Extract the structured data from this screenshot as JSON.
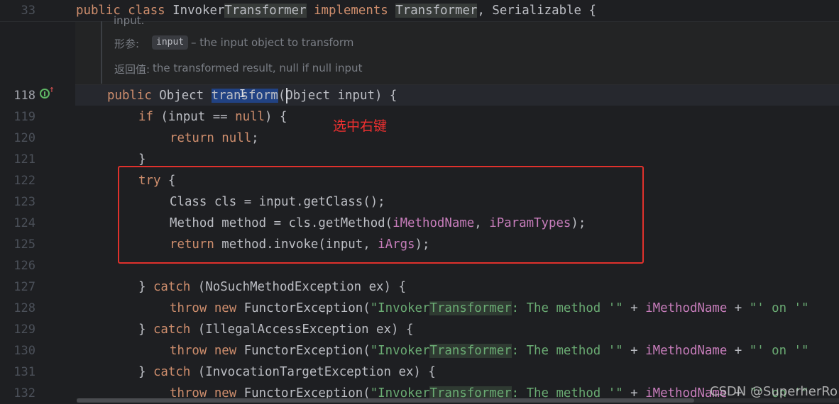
{
  "editor": {
    "sticky_header": {
      "line_number": "33",
      "code": [
        {
          "t": "public class ",
          "c": "kw"
        },
        {
          "t": "Invoker",
          "c": ""
        },
        {
          "t": "Transformer",
          "c": "hl"
        },
        {
          "t": " ",
          "c": ""
        },
        {
          "t": "implements",
          "c": "kw"
        },
        {
          "t": " ",
          "c": ""
        },
        {
          "t": "Transformer",
          "c": "hl"
        },
        {
          "t": ", Serializable {",
          "c": ""
        }
      ]
    },
    "doc_popup": {
      "cut_text": "input.",
      "param_label": "形参:",
      "param_name": "input",
      "param_desc": "– the input object to transform",
      "return_label": "返回值:",
      "return_desc": "the transformed result, null if null input"
    },
    "lines": [
      {
        "num": "118",
        "code": [
          {
            "t": "public ",
            "c": "kw"
          },
          {
            "t": "Object ",
            "c": ""
          },
          {
            "t": "transform",
            "c": "sel"
          },
          {
            "t": "(Object input) {",
            "c": ""
          }
        ]
      },
      {
        "num": "119",
        "code": [
          {
            "t": "if ",
            "c": "kw"
          },
          {
            "t": "(input == ",
            "c": ""
          },
          {
            "t": "null",
            "c": "kw"
          },
          {
            "t": ") {",
            "c": ""
          }
        ]
      },
      {
        "num": "120",
        "code": [
          {
            "t": "return null",
            "c": "kw"
          },
          {
            "t": ";",
            "c": ""
          }
        ]
      },
      {
        "num": "121",
        "code": [
          {
            "t": "}",
            "c": ""
          }
        ]
      },
      {
        "num": "122",
        "code": [
          {
            "t": "try ",
            "c": "kw"
          },
          {
            "t": "{",
            "c": ""
          }
        ]
      },
      {
        "num": "123",
        "code": [
          {
            "t": "Class cls = input.getClass();",
            "c": ""
          }
        ]
      },
      {
        "num": "124",
        "code": [
          {
            "t": "Method method = cls.getMethod(",
            "c": ""
          },
          {
            "t": "iMethodName",
            "c": "fld"
          },
          {
            "t": ", ",
            "c": ""
          },
          {
            "t": "iParamTypes",
            "c": "fld"
          },
          {
            "t": ");",
            "c": ""
          }
        ]
      },
      {
        "num": "125",
        "code": [
          {
            "t": "return ",
            "c": "kw"
          },
          {
            "t": "method.invoke(input, ",
            "c": ""
          },
          {
            "t": "iArgs",
            "c": "fld"
          },
          {
            "t": ");",
            "c": ""
          }
        ]
      },
      {
        "num": "126",
        "code": []
      },
      {
        "num": "127",
        "code": [
          {
            "t": "} ",
            "c": ""
          },
          {
            "t": "catch ",
            "c": "kw"
          },
          {
            "t": "(NoSuchMethodException ex) {",
            "c": ""
          }
        ]
      },
      {
        "num": "128",
        "code": [
          {
            "t": "throw new ",
            "c": "kw"
          },
          {
            "t": "FunctorException(",
            "c": ""
          },
          {
            "t": "\"Invoker",
            "c": "str"
          },
          {
            "t": "Transformer",
            "c": "str strhl"
          },
          {
            "t": ": The method '\"",
            "c": "str"
          },
          {
            "t": " + ",
            "c": ""
          },
          {
            "t": "iMethodName",
            "c": "fld"
          },
          {
            "t": " + ",
            "c": ""
          },
          {
            "t": "\"' on '\"",
            "c": "str"
          }
        ]
      },
      {
        "num": "129",
        "code": [
          {
            "t": "} ",
            "c": ""
          },
          {
            "t": "catch ",
            "c": "kw"
          },
          {
            "t": "(IllegalAccessException ex) {",
            "c": ""
          }
        ]
      },
      {
        "num": "130",
        "code": [
          {
            "t": "throw new ",
            "c": "kw"
          },
          {
            "t": "FunctorException(",
            "c": ""
          },
          {
            "t": "\"Invoker",
            "c": "str"
          },
          {
            "t": "Transformer",
            "c": "str strhl"
          },
          {
            "t": ": The method '\"",
            "c": "str"
          },
          {
            "t": " + ",
            "c": ""
          },
          {
            "t": "iMethodName",
            "c": "fld"
          },
          {
            "t": " + ",
            "c": ""
          },
          {
            "t": "\"' on '\"",
            "c": "str"
          }
        ]
      },
      {
        "num": "131",
        "code": [
          {
            "t": "} ",
            "c": ""
          },
          {
            "t": "catch ",
            "c": "kw"
          },
          {
            "t": "(InvocationTargetException ex) {",
            "c": ""
          }
        ]
      },
      {
        "num": "132",
        "code": [
          {
            "t": "throw new ",
            "c": "kw"
          },
          {
            "t": "FunctorException(",
            "c": ""
          },
          {
            "t": "\"Invoker",
            "c": "str"
          },
          {
            "t": "Transformer",
            "c": "str strhl"
          },
          {
            "t": ": The method '\"",
            "c": "str"
          },
          {
            "t": " + ",
            "c": ""
          },
          {
            "t": "iMethodName",
            "c": "fld"
          },
          {
            "t": " + ",
            "c": ""
          },
          {
            "t": "\"' on '\"",
            "c": "str"
          }
        ]
      }
    ]
  },
  "annotation": "选中右键",
  "watermark": "CSDN @SuperherRo",
  "colors": {
    "keyword": "#cf8e6d",
    "field": "#c77dbb",
    "string": "#6aab73",
    "selection": "#214283",
    "annotation_red": "#e0312c"
  }
}
